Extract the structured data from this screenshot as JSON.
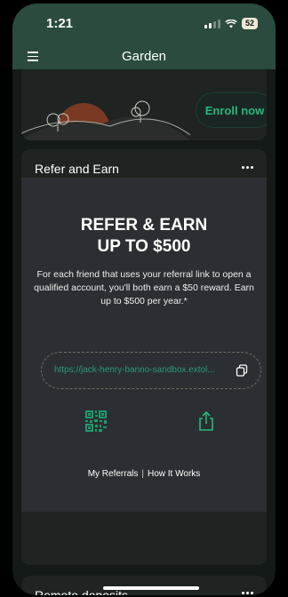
{
  "status": {
    "time": "1:21",
    "battery": "52"
  },
  "header": {
    "title": "Garden"
  },
  "enroll_card": {
    "button_label": "Enroll now"
  },
  "refer_card": {
    "title": "Refer and Earn",
    "headline_1": "REFER & EARN",
    "headline_2": "UP TO $500",
    "description": "For each friend that uses your referral link to open a qualified account, you'll both earn a $50 reward. Earn up to $500 per year.*",
    "referral_link": "https://jack-henry-banno-sandbox.extol...",
    "my_referrals": "My Referrals",
    "separator": "|",
    "how_it_works": "How It Works"
  },
  "deposits_card": {
    "title": "Remote deposits"
  },
  "icons": {
    "menu": "hamburger-menu-icon",
    "more": "more-horizontal-icon",
    "copy": "copy-icon",
    "qr": "qr-code-icon",
    "share": "share-icon"
  },
  "colors": {
    "header_bg": "#2b4b3e",
    "accent_green": "#2bb77e",
    "card_bg": "#1f2422",
    "promo_bg": "#2b2f33"
  }
}
